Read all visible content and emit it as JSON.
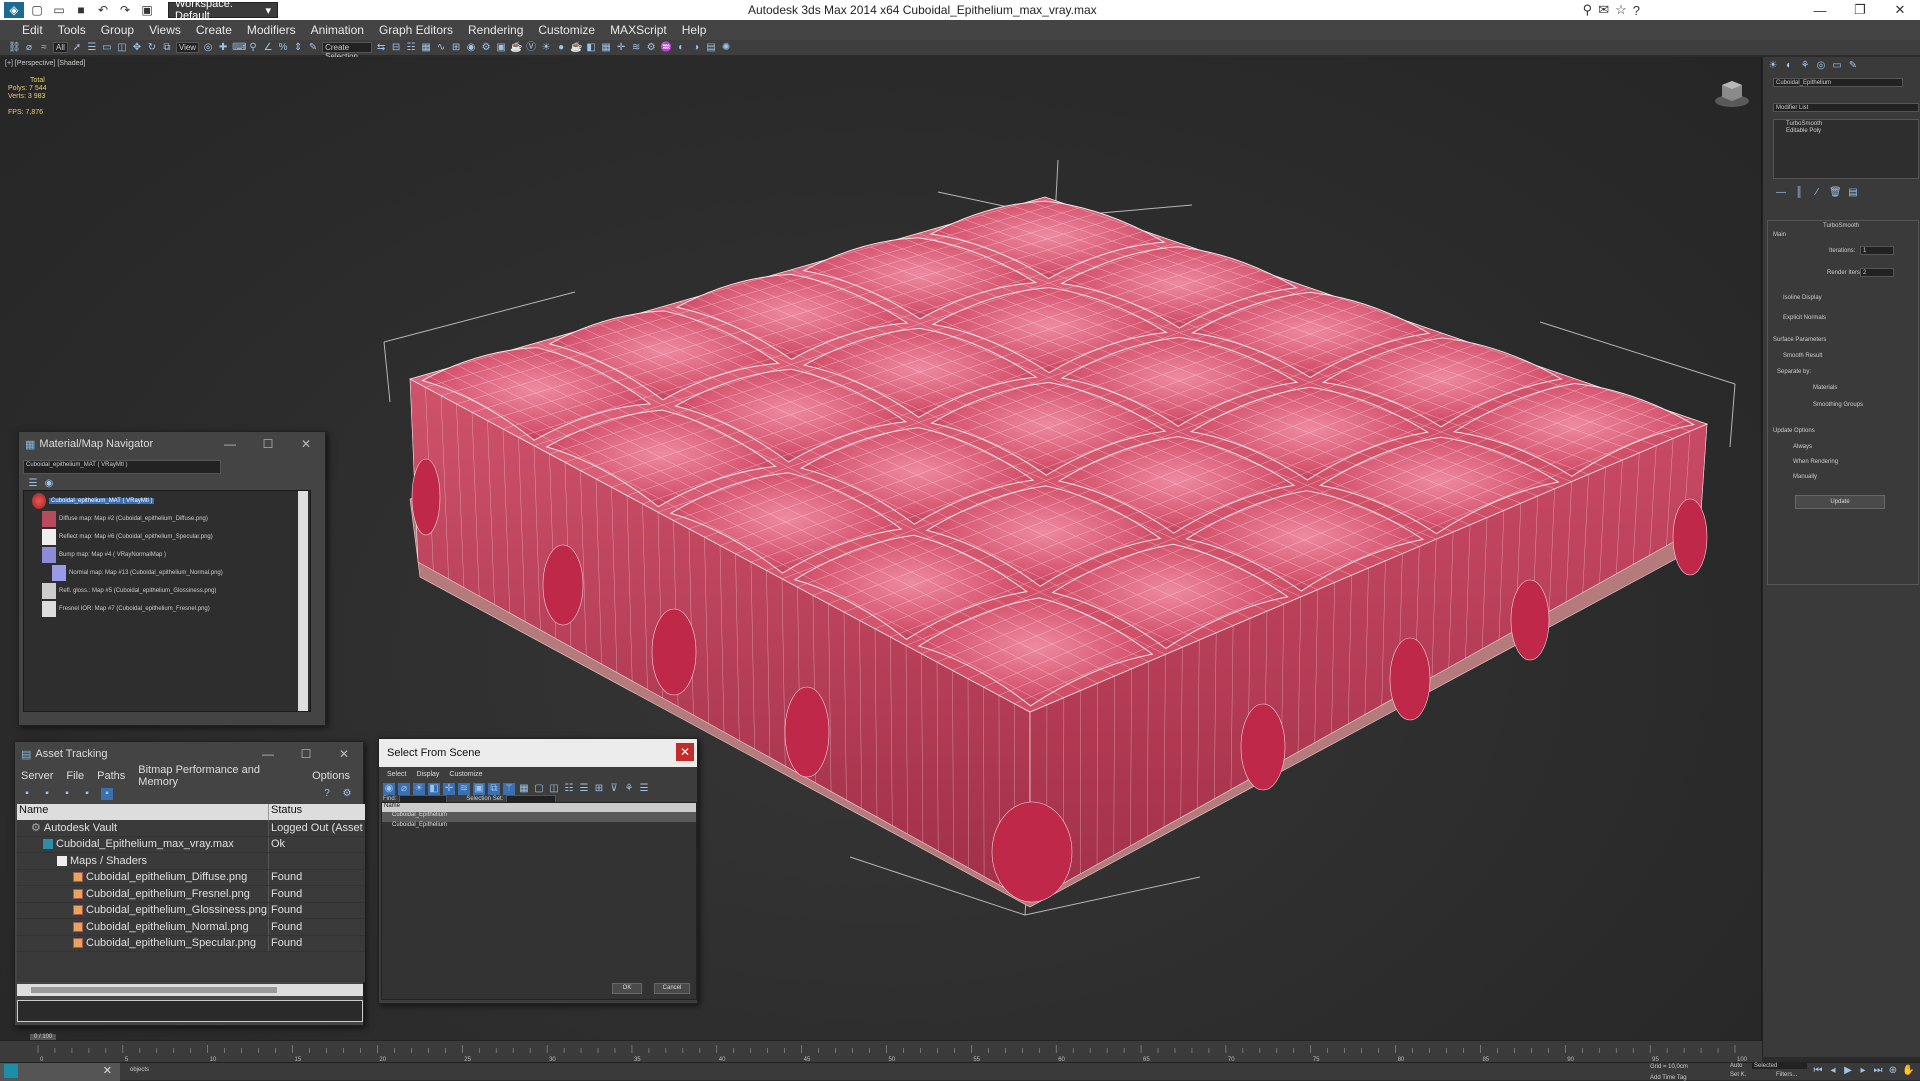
{
  "titlebar": {
    "workspace": "Workspace: Default",
    "app_title": "Autodesk 3ds Max  2014 x64     Cuboidal_Epithelium_max_vray.max"
  },
  "menubar": {
    "items": [
      "Edit",
      "Tools",
      "Group",
      "Views",
      "Create",
      "Modifiers",
      "Animation",
      "Graph Editors",
      "Rendering",
      "Customize",
      "MAXScript",
      "Help"
    ]
  },
  "toolbar": {
    "filter": "All",
    "view": "View",
    "selection_set": "Create Selection"
  },
  "viewport": {
    "label": "[+] [Perspective] [Shaded]",
    "stats": {
      "total_label": "Total",
      "polys_label": "Polys:",
      "polys": "7 544",
      "verts_label": "Verts:",
      "verts": "3 983",
      "fps_label": "FPS:",
      "fps": "7,876"
    }
  },
  "command_panel": {
    "object_name": "Cuboidal_Epithelium",
    "modifier_list": "Modifier List",
    "stack": [
      "TurboSmooth",
      "Editable Poly"
    ],
    "rollout_title": "TurboSmooth",
    "main_label": "Main",
    "iterations_label": "Iterations:",
    "iterations": "1",
    "render_iters_label": "Render Iters:",
    "render_iters": "2",
    "isoline": "Isoline Display",
    "explicit_normals": "Explicit Normals",
    "surface_params": "Surface Parameters",
    "smooth_result": "Smooth Result",
    "separate_by": "Separate by:",
    "materials": "Materials",
    "smoothing_groups": "Smoothing Groups",
    "update_options": "Update Options",
    "always": "Always",
    "when_rendering": "When Rendering",
    "manually": "Manually",
    "update_btn": "Update"
  },
  "material_navigator": {
    "title": "Material/Map Navigator",
    "field": "Cuboidal_epithelium_MAT  ( VRayMtl )",
    "rows": [
      "Cuboidal_epithelium_MAT  ( VRayMtl )",
      "Diffuse map: Map #2 (Cuboidal_epithelium_Diffuse.png)",
      "Reflect map: Map #6 (Cuboidal_epithelium_Specular.png)",
      "Bump map: Map #4  ( VRayNormalMap )",
      "Normal map: Map #13 (Cuboidal_epithelium_Normal.png)",
      "Refl. gloss.: Map #5 (Cuboidal_epithelium_Glossiness.png)",
      "Fresnel IOR: Map #7 (Cuboidal_epithelium_Fresnel.png)"
    ]
  },
  "asset_tracking": {
    "title": "Asset Tracking",
    "menu": [
      "Server",
      "File",
      "Paths",
      "Bitmap Performance and Memory",
      "Options"
    ],
    "col_name": "Name",
    "col_status": "Status",
    "rows": [
      {
        "name": "Autodesk Vault",
        "status": "Logged Out (Asset Tr"
      },
      {
        "name": "Cuboidal_Epithelium_max_vray.max",
        "status": "Ok"
      },
      {
        "name": "Maps / Shaders",
        "status": ""
      },
      {
        "name": "Cuboidal_epithelium_Diffuse.png",
        "status": "Found"
      },
      {
        "name": "Cuboidal_epithelium_Fresnel.png",
        "status": "Found"
      },
      {
        "name": "Cuboidal_epithelium_Glossiness.png",
        "status": "Found"
      },
      {
        "name": "Cuboidal_epithelium_Normal.png",
        "status": "Found"
      },
      {
        "name": "Cuboidal_epithelium_Specular.png",
        "status": "Found"
      }
    ]
  },
  "select_from_scene": {
    "title": "Select From Scene",
    "menu": [
      "Select",
      "Display",
      "Customize"
    ],
    "find_label": "Find:",
    "selection_set": "Selection Set:",
    "col_name": "Name",
    "items": [
      "Cuboidal_Epithelium",
      "Cuboidal_Epithelium"
    ],
    "ok": "OK",
    "cancel": "Cancel"
  },
  "timeline": {
    "frame": "0 / 100",
    "ticks": [
      "0",
      "5",
      "10",
      "15",
      "20",
      "25",
      "30",
      "35",
      "40",
      "45",
      "50",
      "55",
      "60",
      "65",
      "70",
      "75",
      "80",
      "85",
      "90",
      "95",
      "100"
    ]
  },
  "statusbar": {
    "objects": "objects",
    "grid": "Grid = 10,0cm",
    "auto": "Auto",
    "set_k": "Set K.",
    "selected": "Selected",
    "filters": "Filters...",
    "add_time_tag": "Add Time Tag"
  },
  "colors": {
    "tissue": "#d9536b",
    "tissue_dark": "#a8304a",
    "wire": "#f4e4e8",
    "panel": "#444444"
  }
}
